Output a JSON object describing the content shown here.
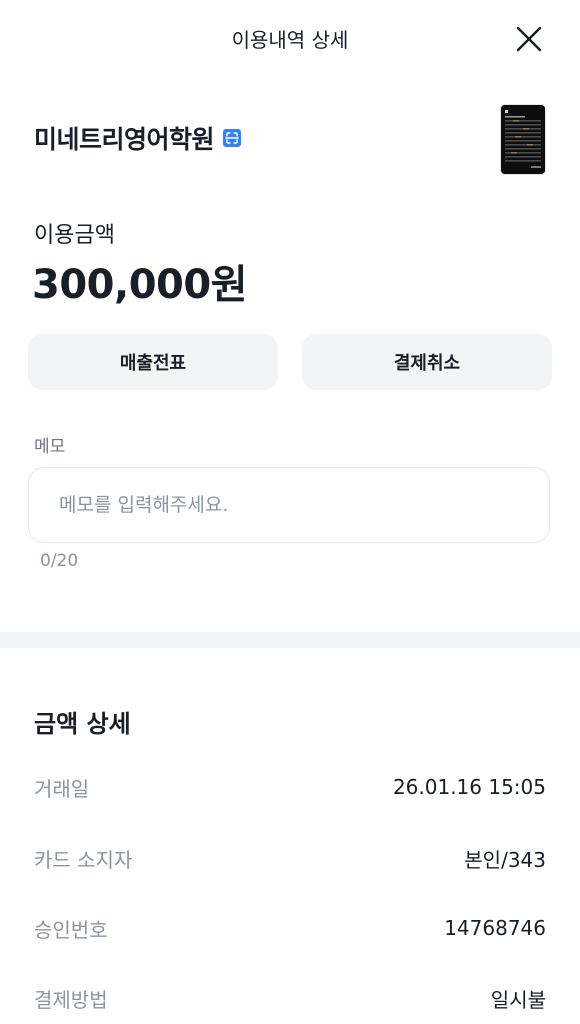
{
  "header": {
    "title": "이용내역 상세",
    "close_icon": "close-icon"
  },
  "merchant": {
    "name": "미네트리영어학원",
    "icon": "scan-icon",
    "icon_color": "#3182f6"
  },
  "amount": {
    "label": "이용금액",
    "value": "300,000원"
  },
  "actions": {
    "receipt_label": "매출전표",
    "cancel_label": "결제취소"
  },
  "memo": {
    "label": "메모",
    "value": "",
    "placeholder": "메모를 입력해주세요.",
    "counter": "0/20"
  },
  "details": {
    "title": "금액 상세",
    "rows": [
      {
        "label": "거래일",
        "value": "26.01.16 15:05"
      },
      {
        "label": "카드 소지자",
        "value": "본인/343"
      },
      {
        "label": "승인번호",
        "value": "14768746"
      },
      {
        "label": "결제방법",
        "value": "일시불"
      }
    ]
  }
}
